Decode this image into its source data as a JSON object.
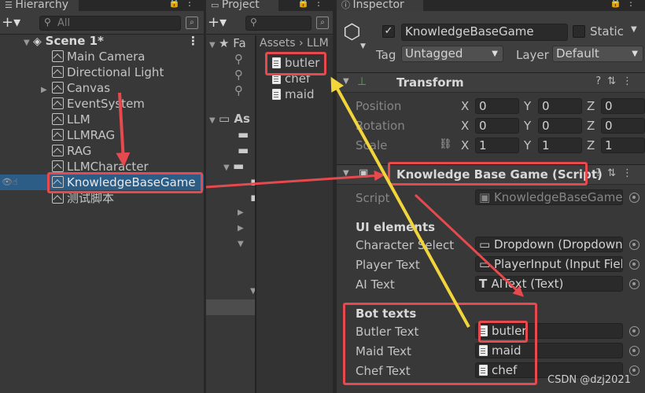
{
  "hierarchy": {
    "tab": "Hierarchy",
    "search_placeholder": "All",
    "scene": "Scene 1*",
    "items": [
      "Main Camera",
      "Directional Light",
      "Canvas",
      "EventSystem",
      "LLM",
      "LLMRAG",
      "RAG",
      "LLMCharacter",
      "KnowledgeBaseGame",
      "测试脚本"
    ]
  },
  "project": {
    "tab": "Project",
    "favorites": "Fa",
    "breadcrumb": "Assets › LLM",
    "assets": "As",
    "files": [
      "butler",
      "chef",
      "maid"
    ]
  },
  "inspector": {
    "tab": "Inspector",
    "object_name": "KnowledgeBaseGame",
    "static_label": "Static",
    "tag_label": "Tag",
    "tag_value": "Untagged",
    "layer_label": "Layer",
    "layer_value": "Default",
    "transform": {
      "title": "Transform",
      "rows": [
        {
          "label": "Position",
          "x": "0",
          "y": "0",
          "z": "0"
        },
        {
          "label": "Rotation",
          "x": "0",
          "y": "0",
          "z": "0"
        },
        {
          "label": "Scale",
          "x": "1",
          "y": "1",
          "z": "1"
        }
      ]
    },
    "script_component": {
      "title": "Knowledge Base Game (Script)",
      "script_label": "Script",
      "script_value": "KnowledgeBaseGame",
      "ui_header": "UI elements",
      "ui_rows": [
        {
          "label": "Character Select",
          "value": "Dropdown (Dropdown)"
        },
        {
          "label": "Player Text",
          "value": "PlayerInput (Input Field)"
        },
        {
          "label": "AI Text",
          "value": "AIText (Text)"
        }
      ],
      "bot_header": "Bot texts",
      "bot_rows": [
        {
          "label": "Butler Text",
          "value": "butler"
        },
        {
          "label": "Maid Text",
          "value": "maid"
        },
        {
          "label": "Chef Text",
          "value": "chef"
        }
      ]
    }
  },
  "watermark": "CSDN @dzj2021",
  "colors": {
    "selection": "#2c5d87",
    "highlight_box": "#e6494e",
    "arrow_red": "#e6494e",
    "arrow_yellow": "#f2d43b"
  }
}
